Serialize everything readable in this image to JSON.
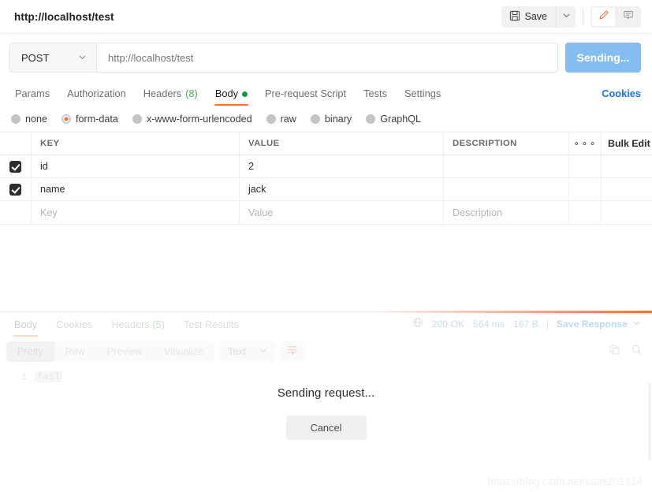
{
  "topbar": {
    "request_title": "http://localhost/test",
    "save_label": "Save",
    "save_icon": "floppy-disk-icon",
    "save_caret_icon": "chevron-down-icon",
    "edit_icon": "pencil-icon",
    "comment_icon": "comment-icon",
    "accent_orange": "#ff6c37"
  },
  "urlbar": {
    "method": "POST",
    "method_caret_icon": "chevron-down-icon",
    "url_value": "",
    "url_placeholder": "http://localhost/test",
    "send_label": "Sending...",
    "send_color": "#85bdf0"
  },
  "request_tabs": {
    "items": [
      {
        "label": "Params",
        "count": "",
        "active": false,
        "dot": false
      },
      {
        "label": "Authorization",
        "count": "",
        "active": false,
        "dot": false
      },
      {
        "label": "Headers",
        "count": "(8)",
        "active": false,
        "dot": false
      },
      {
        "label": "Body",
        "count": "",
        "active": true,
        "dot": true
      },
      {
        "label": "Pre-request Script",
        "count": "",
        "active": false,
        "dot": false
      },
      {
        "label": "Tests",
        "count": "",
        "active": false,
        "dot": false
      },
      {
        "label": "Settings",
        "count": "",
        "active": false,
        "dot": false
      }
    ],
    "cookies_link": "Cookies",
    "cookies_color": "#1a73e8"
  },
  "body_types": {
    "options": [
      {
        "label": "none",
        "selected": false
      },
      {
        "label": "form-data",
        "selected": true
      },
      {
        "label": "x-www-form-urlencoded",
        "selected": false
      },
      {
        "label": "raw",
        "selected": false
      },
      {
        "label": "binary",
        "selected": false
      },
      {
        "label": "GraphQL",
        "selected": false
      }
    ]
  },
  "kv_table": {
    "headers": {
      "key": "KEY",
      "value": "VALUE",
      "description": "DESCRIPTION",
      "more_icon": "ellipsis-icon",
      "bulk_edit": "Bulk Edit"
    },
    "rows": [
      {
        "checked": true,
        "key": "id",
        "value": "2",
        "description": ""
      },
      {
        "checked": true,
        "key": "name",
        "value": "jack",
        "description": ""
      }
    ],
    "placeholder_row": {
      "key": "Key",
      "value": "Value",
      "description": "Description"
    }
  },
  "response": {
    "tabs": [
      {
        "label": "Body",
        "count": "",
        "active": true
      },
      {
        "label": "Cookies",
        "count": "",
        "active": false
      },
      {
        "label": "Headers",
        "count": "(5)",
        "active": false
      },
      {
        "label": "Test Results",
        "count": "",
        "active": false
      }
    ],
    "meta": {
      "globe_icon": "globe-icon",
      "status": "200 OK",
      "time": "564 ms",
      "size": "167 B",
      "save_response": "Save Response",
      "save_response_caret_icon": "chevron-down-icon"
    },
    "toolbar": {
      "view_modes": [
        {
          "label": "Pretty",
          "active": true
        },
        {
          "label": "Raw",
          "active": false
        },
        {
          "label": "Preview",
          "active": false
        },
        {
          "label": "Visualize",
          "active": false
        }
      ],
      "format": "Text",
      "format_caret_icon": "chevron-down-icon",
      "wrap_icon": "word-wrap-icon",
      "copy_icon": "copy-icon",
      "search_icon": "search-icon"
    },
    "body": {
      "line_number": "1",
      "content": "fail"
    }
  },
  "overlay": {
    "message": "Sending request...",
    "cancel_label": "Cancel"
  },
  "watermark": "https://blog.csdn.net/caoli201314"
}
